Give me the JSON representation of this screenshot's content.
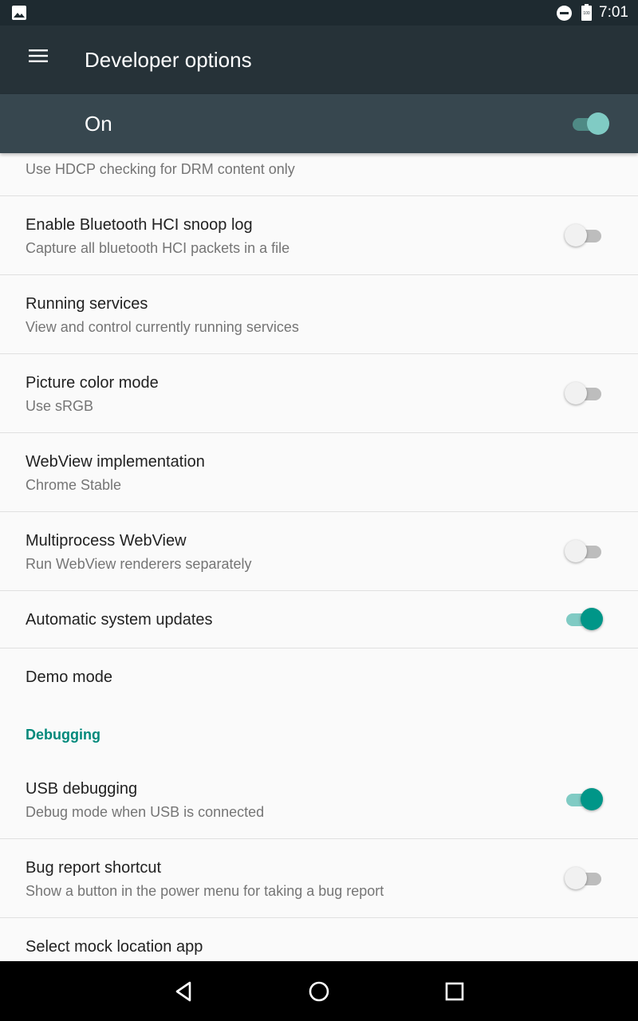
{
  "status_bar": {
    "time": "7:01",
    "battery_level_text": "100",
    "icons": [
      "image-icon",
      "do-not-disturb-icon",
      "battery-icon"
    ]
  },
  "app_bar": {
    "title": "Developer options",
    "menu_icon": "hamburger-menu-icon"
  },
  "master_switch": {
    "label": "On",
    "checked": true
  },
  "settings": [
    {
      "title": "",
      "summary": "Use HDCP checking for DRM content only",
      "switch": null
    },
    {
      "title": "Enable Bluetooth HCI snoop log",
      "summary": "Capture all bluetooth HCI packets in a file",
      "switch": false
    },
    {
      "title": "Running services",
      "summary": "View and control currently running services",
      "switch": null
    },
    {
      "title": "Picture color mode",
      "summary": "Use sRGB",
      "switch": false
    },
    {
      "title": "WebView implementation",
      "summary": "Chrome Stable",
      "switch": null
    },
    {
      "title": "Multiprocess WebView",
      "summary": "Run WebView renderers separately",
      "switch": false
    },
    {
      "title": "Automatic system updates",
      "summary": "",
      "switch": true
    },
    {
      "title": "Demo mode",
      "summary": "",
      "switch": null
    }
  ],
  "debugging": {
    "header": "Debugging",
    "items": [
      {
        "title": "USB debugging",
        "summary": "Debug mode when USB is connected",
        "switch": true
      },
      {
        "title": "Bug report shortcut",
        "summary": "Show a button in the power menu for taking a bug report",
        "switch": false
      },
      {
        "title": "Select mock location app",
        "summary": "",
        "switch": null
      }
    ]
  },
  "nav_bar": {
    "buttons": [
      "back-icon",
      "home-icon",
      "recents-icon"
    ]
  },
  "colors": {
    "accent": "#009688",
    "app_bar": "#263238",
    "master_bar": "#37474f",
    "status_bar": "#1e2a30",
    "section_header": "#00897b"
  }
}
